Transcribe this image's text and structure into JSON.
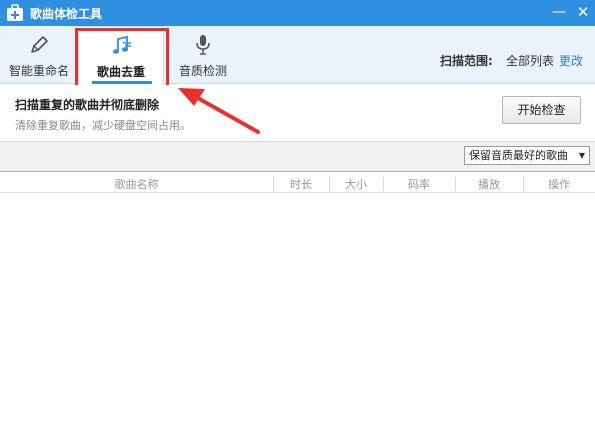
{
  "window": {
    "title": "歌曲体检工具",
    "min_glyph": "—",
    "close_glyph": "✕"
  },
  "toolbar": {
    "tools": [
      {
        "label": "智能重命名",
        "icon": "pencil-icon"
      },
      {
        "label": "歌曲去重",
        "icon": "music-note-icon",
        "active": true
      },
      {
        "label": "音质检测",
        "icon": "microphone-icon"
      }
    ],
    "scope_label": "扫描范围:",
    "scope_value": "全部列表",
    "scope_change": "更改"
  },
  "header": {
    "headline": "扫描重复的歌曲并彻底删除",
    "subline": "清除重复歌曲，减少硬盘空间占用。",
    "start_button": "开始检查"
  },
  "filter": {
    "selected": "保留音质最好的歌曲"
  },
  "table": {
    "columns": [
      "歌曲名称",
      "时长",
      "大小",
      "码率",
      "播放",
      "操作"
    ],
    "rows": []
  },
  "colors": {
    "titlebar": "#2f8fe0",
    "accent": "#2f8fe0",
    "annotation": "#e8312b",
    "link": "#2f7fd0"
  }
}
